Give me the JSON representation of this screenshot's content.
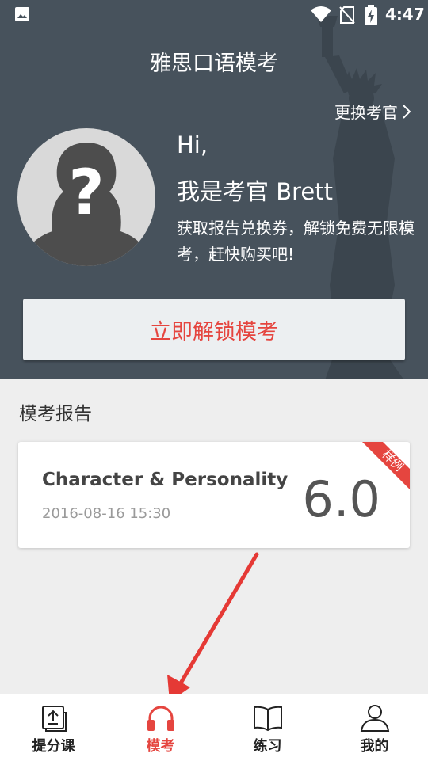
{
  "status_bar": {
    "time": "4:47"
  },
  "header": {
    "title": "雅思口语模考",
    "change_examiner": "更换考官"
  },
  "examiner": {
    "greeting": "Hi,",
    "intro": "我是考官 Brett",
    "description": "获取报告兑换券，解锁免费无限模考，赶快购买吧!"
  },
  "unlock_button": {
    "label": "立即解锁模考"
  },
  "reports": {
    "section_title": "模考报告",
    "items": [
      {
        "topic": "Character & Personality",
        "date": "2016-08-16 15:30",
        "score": "6.0",
        "badge": "样例"
      }
    ]
  },
  "tabs": [
    {
      "label": "提分课",
      "icon": "book-upload-icon",
      "active": false
    },
    {
      "label": "模考",
      "icon": "headphones-icon",
      "active": true
    },
    {
      "label": "练习",
      "icon": "open-book-icon",
      "active": false
    },
    {
      "label": "我的",
      "icon": "user-icon",
      "active": false
    }
  ],
  "colors": {
    "hero_background": "#47525c",
    "accent": "#e5453f",
    "page_background": "#eeeeee"
  }
}
